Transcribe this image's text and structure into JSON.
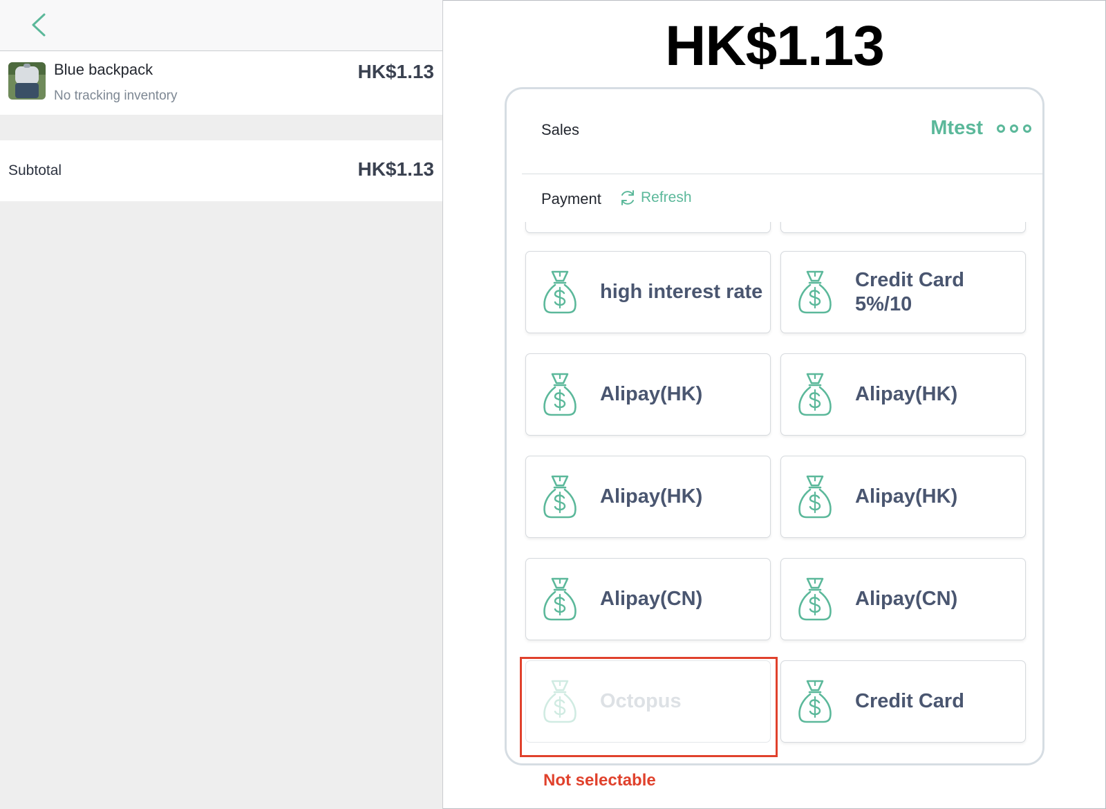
{
  "cart": {
    "item": {
      "name": "Blue backpack",
      "subtitle": "No tracking inventory",
      "price": "HK$1.13"
    },
    "subtotal_label": "Subtotal",
    "subtotal_value": "HK$1.13"
  },
  "checkout": {
    "total": "HK$1.13",
    "sales_label": "Sales",
    "store_name": "Mtest",
    "payment_label": "Payment",
    "refresh_label": "Refresh",
    "methods": [
      {
        "label": "high interest rate",
        "enabled": true
      },
      {
        "label": "Credit Card 5%/10",
        "enabled": true
      },
      {
        "label": "Alipay(HK)",
        "enabled": true
      },
      {
        "label": "Alipay(HK)",
        "enabled": true
      },
      {
        "label": "Alipay(HK)",
        "enabled": true
      },
      {
        "label": "Alipay(HK)",
        "enabled": true
      },
      {
        "label": "Alipay(CN)",
        "enabled": true
      },
      {
        "label": "Alipay(CN)",
        "enabled": true
      },
      {
        "label": "Octopus",
        "enabled": false
      },
      {
        "label": "Credit Card",
        "enabled": true
      }
    ]
  },
  "annotation": {
    "text": "Not selectable",
    "color": "#e0412c"
  },
  "icons": {
    "back": "chevron-left-icon",
    "more": "more-dots-icon",
    "refresh": "refresh-icon",
    "method": "money-bag-icon"
  },
  "colors": {
    "accent": "#5bb89a",
    "label": "#4a5670",
    "disabled_label": "#dde1e5"
  }
}
